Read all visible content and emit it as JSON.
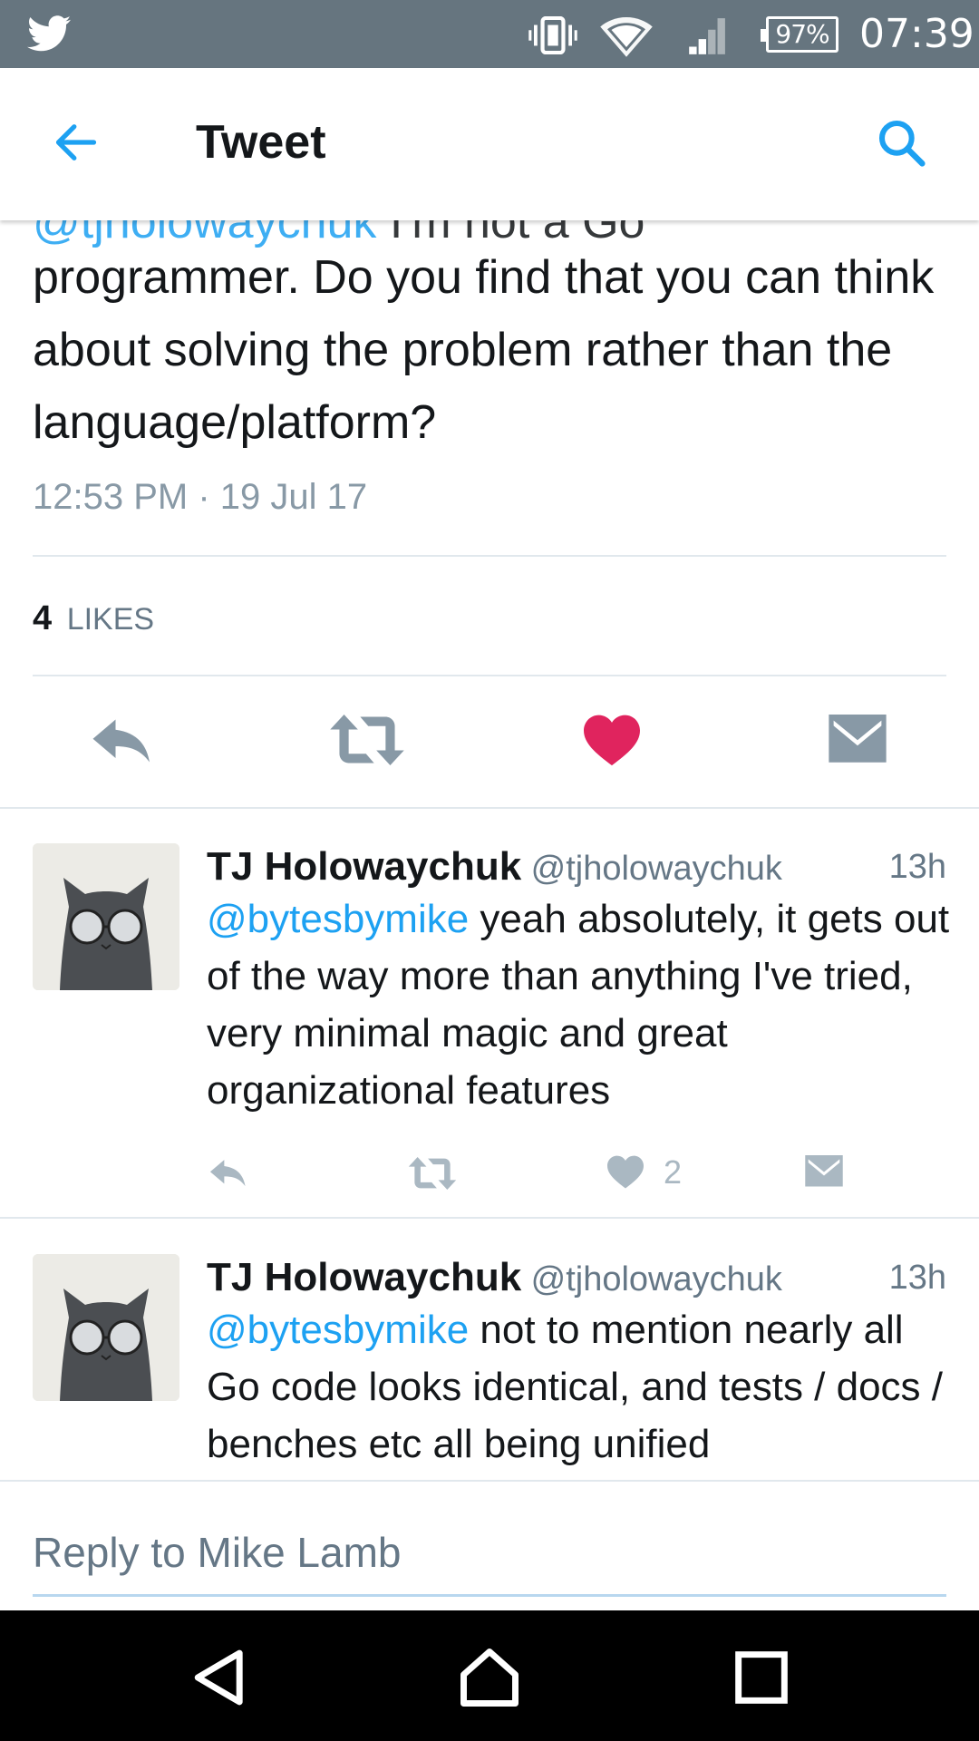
{
  "status_bar": {
    "battery": "97%",
    "time": "07:39",
    "icons": [
      "twitter-bird-icon",
      "vibrate-icon",
      "wifi-icon",
      "cell-signal-icon",
      "battery-icon"
    ]
  },
  "app_bar": {
    "title": "Tweet",
    "back_icon": "arrow-left-icon",
    "search_icon": "search-icon"
  },
  "tweet": {
    "partial_mention": "@tjholowaychuk",
    "partial_rest": " I'm not a Go",
    "text": "programmer. Do you find that you can think about solving the problem rather than the language/platform?",
    "timestamp": "12:53 PM · 19 Jul 17",
    "likes_count": "4",
    "likes_label": "LIKES",
    "actions": [
      "reply-icon",
      "retweet-icon",
      "heart-icon",
      "message-icon"
    ],
    "liked": true
  },
  "replies": [
    {
      "name": "TJ Holowaychuk",
      "handle": "@tjholowaychuk",
      "age": "13h",
      "mention": "@bytesbymike",
      "text": " yeah absolutely, it gets out of the way more than anything I've tried, very minimal magic and great organizational features",
      "like_count": "2"
    },
    {
      "name": "TJ Holowaychuk",
      "handle": "@tjholowaychuk",
      "age": "13h",
      "mention": "@bytesbymike",
      "text": " not to mention nearly all Go code looks identical, and tests / docs / benches etc all being unified",
      "like_count": ""
    }
  ],
  "composer": {
    "placeholder": "Reply to Mike Lamb"
  },
  "nav_bar": {
    "icons": [
      "back-triangle-icon",
      "home-icon",
      "recents-icon"
    ]
  },
  "colors": {
    "brand_blue": "#1da1f2",
    "like_red": "#e0245e",
    "status_bar": "#66757f",
    "muted_text": "#657786"
  }
}
